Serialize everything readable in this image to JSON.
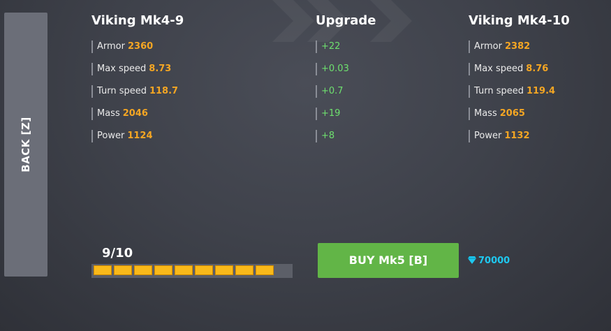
{
  "back_label": "BACK [Z]",
  "current": {
    "title": "Viking Mk4-9",
    "stats": [
      {
        "label": "Armor",
        "value": "2360"
      },
      {
        "label": "Max speed",
        "value": "8.73"
      },
      {
        "label": "Turn speed",
        "value": "118.7"
      },
      {
        "label": "Mass",
        "value": "2046"
      },
      {
        "label": "Power",
        "value": "1124"
      }
    ]
  },
  "upgrade": {
    "title": "Upgrade",
    "deltas": [
      "+22",
      "+0.03",
      "+0.7",
      "+19",
      "+8"
    ]
  },
  "next": {
    "title": "Viking Mk4-10",
    "stats": [
      {
        "label": "Armor",
        "value": "2382"
      },
      {
        "label": "Max speed",
        "value": "8.76"
      },
      {
        "label": "Turn speed",
        "value": "119.4"
      },
      {
        "label": "Mass",
        "value": "2065"
      },
      {
        "label": "Power",
        "value": "1132"
      }
    ]
  },
  "progress": {
    "label": "9/10",
    "filled": 9,
    "total": 10
  },
  "buy_label": "BUY Mk5 [B]",
  "price": "70000",
  "price_icon": "diamond-icon",
  "colors": {
    "value": "#f5a623",
    "delta": "#6ee06e",
    "buy": "#62b547",
    "price": "#1ec8f0",
    "progress": "#f9b91a"
  }
}
